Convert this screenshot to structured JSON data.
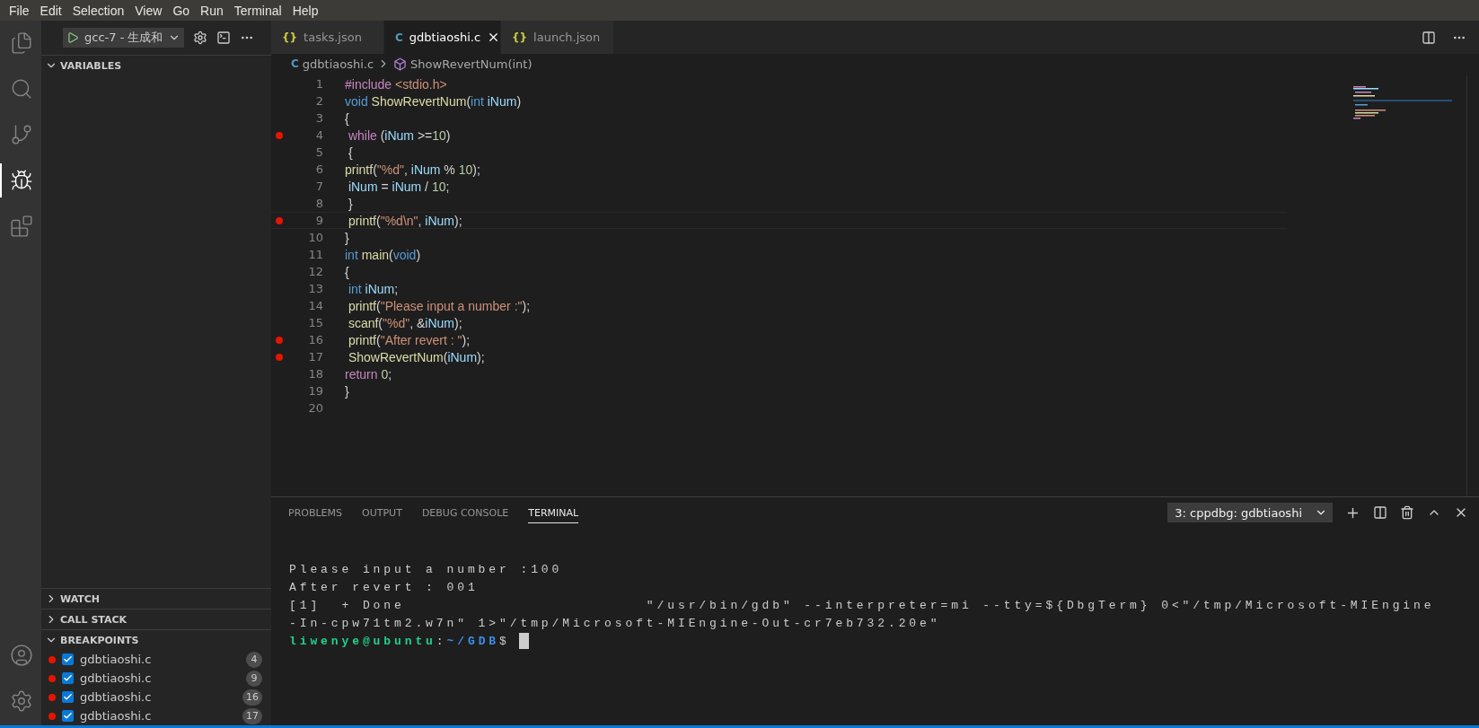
{
  "menu": [
    "File",
    "Edit",
    "Selection",
    "View",
    "Go",
    "Run",
    "Terminal",
    "Help"
  ],
  "activity_bar": [
    {
      "kind": "files",
      "selected": false
    },
    {
      "kind": "search",
      "selected": false
    },
    {
      "kind": "source-control",
      "selected": false
    },
    {
      "kind": "debug",
      "selected": true
    },
    {
      "kind": "extensions",
      "selected": false
    }
  ],
  "activity_bottom": [
    {
      "kind": "account"
    },
    {
      "kind": "settings"
    }
  ],
  "debug_toolbar": {
    "config": "gcc-7 - 生成和"
  },
  "sidebar_sections": [
    {
      "title": "VARIABLES",
      "expanded": true
    },
    {
      "title": "WATCH",
      "expanded": false
    },
    {
      "title": "CALL STACK",
      "expanded": false
    },
    {
      "title": "BREAKPOINTS",
      "expanded": true,
      "items": [
        {
          "file": "gdbtiaoshi.c",
          "checked": true,
          "line": "4"
        },
        {
          "file": "gdbtiaoshi.c",
          "checked": true,
          "line": "9"
        },
        {
          "file": "gdbtiaoshi.c",
          "checked": true,
          "line": "16"
        },
        {
          "file": "gdbtiaoshi.c",
          "checked": true,
          "line": "17"
        }
      ]
    }
  ],
  "editor_tabs": [
    {
      "icon": "{}",
      "kind": "json",
      "label": "tasks.json",
      "selected": false
    },
    {
      "icon": "C",
      "kind": "c",
      "label": "gdbtiaoshi.c",
      "selected": true
    },
    {
      "icon": "{}",
      "kind": "json",
      "label": "launch.json",
      "selected": false
    }
  ],
  "breadcrumb": {
    "file_icon": "C",
    "file": "gdbtiaoshi.c",
    "symbol": "ShowRevertNum(int)"
  },
  "code": {
    "lines": [
      {
        "number": "1",
        "breakpoint": false,
        "current": false,
        "tokens": [
          {
            "t": "#include",
            "kind": "pre"
          },
          {
            "t": " <stdio.h>",
            "kind": "str"
          }
        ]
      },
      {
        "number": "2",
        "breakpoint": false,
        "current": false,
        "tokens": [
          {
            "t": "void",
            "kind": "kw"
          },
          {
            "t": " ShowRevertNum",
            "kind": "fn"
          },
          {
            "t": "(",
            "kind": "p"
          },
          {
            "t": "int",
            "kind": "kw"
          },
          {
            "t": " iNum",
            "kind": "var"
          },
          {
            "t": ")",
            "kind": "p"
          }
        ]
      },
      {
        "number": "3",
        "breakpoint": false,
        "current": false,
        "tokens": [
          {
            "t": "{",
            "kind": "p"
          }
        ]
      },
      {
        "number": "4",
        "breakpoint": true,
        "current": false,
        "tokens": [
          {
            "t": " while",
            "kind": "ctl"
          },
          {
            "t": " (",
            "kind": "p"
          },
          {
            "t": "iNum",
            "kind": "var"
          },
          {
            "t": " >=",
            "kind": "p"
          },
          {
            "t": "10",
            "kind": "num"
          },
          {
            "t": ")",
            "kind": "p"
          }
        ]
      },
      {
        "number": "5",
        "breakpoint": false,
        "current": false,
        "tokens": [
          {
            "t": " {",
            "kind": "p"
          }
        ]
      },
      {
        "number": "6",
        "breakpoint": false,
        "current": false,
        "tokens": [
          {
            "t": "printf",
            "kind": "fn"
          },
          {
            "t": "(",
            "kind": "p"
          },
          {
            "t": "\"%d\"",
            "kind": "str"
          },
          {
            "t": ", ",
            "kind": "p"
          },
          {
            "t": "iNum",
            "kind": "var"
          },
          {
            "t": " % ",
            "kind": "p"
          },
          {
            "t": "10",
            "kind": "num"
          },
          {
            "t": ");",
            "kind": "p"
          }
        ]
      },
      {
        "number": "7",
        "breakpoint": false,
        "current": false,
        "tokens": [
          {
            "t": " iNum",
            "kind": "var"
          },
          {
            "t": " = ",
            "kind": "p"
          },
          {
            "t": "iNum",
            "kind": "var"
          },
          {
            "t": " / ",
            "kind": "p"
          },
          {
            "t": "10",
            "kind": "num"
          },
          {
            "t": ";",
            "kind": "p"
          }
        ]
      },
      {
        "number": "8",
        "breakpoint": false,
        "current": false,
        "tokens": [
          {
            "t": " }",
            "kind": "p"
          }
        ]
      },
      {
        "number": "9",
        "breakpoint": true,
        "current": true,
        "tokens": [
          {
            "t": " printf",
            "kind": "fn"
          },
          {
            "t": "(",
            "kind": "p"
          },
          {
            "t": "\"%d\\n\"",
            "kind": "str"
          },
          {
            "t": ", ",
            "kind": "p"
          },
          {
            "t": "iNum",
            "kind": "var"
          },
          {
            "t": ");",
            "kind": "p"
          }
        ]
      },
      {
        "number": "10",
        "breakpoint": false,
        "current": false,
        "tokens": [
          {
            "t": "}",
            "kind": "p"
          }
        ]
      },
      {
        "number": "11",
        "breakpoint": false,
        "current": false,
        "tokens": [
          {
            "t": "int",
            "kind": "kw"
          },
          {
            "t": " main",
            "kind": "fn"
          },
          {
            "t": "(",
            "kind": "p"
          },
          {
            "t": "void",
            "kind": "kw"
          },
          {
            "t": ")",
            "kind": "p"
          }
        ]
      },
      {
        "number": "12",
        "breakpoint": false,
        "current": false,
        "tokens": [
          {
            "t": "{",
            "kind": "p"
          }
        ]
      },
      {
        "number": "13",
        "breakpoint": false,
        "current": false,
        "tokens": [
          {
            "t": " int",
            "kind": "kw"
          },
          {
            "t": " iNum",
            "kind": "var"
          },
          {
            "t": ";",
            "kind": "p"
          }
        ]
      },
      {
        "number": "14",
        "breakpoint": false,
        "current": false,
        "tokens": [
          {
            "t": " printf",
            "kind": "fn"
          },
          {
            "t": "(",
            "kind": "p"
          },
          {
            "t": "\"Please input a number :\"",
            "kind": "str"
          },
          {
            "t": ");",
            "kind": "p"
          }
        ]
      },
      {
        "number": "15",
        "breakpoint": false,
        "current": false,
        "tokens": [
          {
            "t": " scanf",
            "kind": "fn"
          },
          {
            "t": "(",
            "kind": "p"
          },
          {
            "t": "\"%d\"",
            "kind": "str"
          },
          {
            "t": ", &",
            "kind": "p"
          },
          {
            "t": "iNum",
            "kind": "var"
          },
          {
            "t": ");",
            "kind": "p"
          }
        ]
      },
      {
        "number": "16",
        "breakpoint": true,
        "current": false,
        "tokens": [
          {
            "t": " printf",
            "kind": "fn"
          },
          {
            "t": "(",
            "kind": "p"
          },
          {
            "t": "\"After revert : \"",
            "kind": "str"
          },
          {
            "t": ");",
            "kind": "p"
          }
        ]
      },
      {
        "number": "17",
        "breakpoint": true,
        "current": false,
        "tokens": [
          {
            "t": " ShowRevertNum",
            "kind": "fn"
          },
          {
            "t": "(",
            "kind": "p"
          },
          {
            "t": "iNum",
            "kind": "var"
          },
          {
            "t": ");",
            "kind": "p"
          }
        ]
      },
      {
        "number": "18",
        "breakpoint": false,
        "current": false,
        "tokens": [
          {
            "t": "return",
            "kind": "ctl"
          },
          {
            "t": " 0",
            "kind": "num"
          },
          {
            "t": ";",
            "kind": "p"
          }
        ]
      },
      {
        "number": "19",
        "breakpoint": false,
        "current": false,
        "tokens": [
          {
            "t": "}",
            "kind": "p"
          }
        ]
      },
      {
        "number": "20",
        "breakpoint": false,
        "current": false
      }
    ]
  },
  "panel_tabs": [
    {
      "label": "PROBLEMS",
      "selected": false
    },
    {
      "label": "OUTPUT",
      "selected": false
    },
    {
      "label": "DEBUG CONSOLE",
      "selected": false
    },
    {
      "label": "TERMINAL",
      "selected": true
    }
  ],
  "terminal_select": "3: cppdbg: gdbtiaoshi",
  "terminal_lines": [
    [
      {
        "t": "Please input a number :100",
        "kind": "plain"
      }
    ],
    [
      {
        "t": "After revert : 001",
        "kind": "plain"
      }
    ],
    [
      {
        "t": "[1]  + Done                       \"/usr/bin/gdb\" --interpreter=mi --tty=${DbgTerm} 0<\"/tmp/Microsoft-MIEngine",
        "kind": "plain"
      }
    ],
    [
      {
        "t": "-In-cpw71tm2.w7n\" 1>\"/tmp/Microsoft-MIEngine-Out-cr7eb732.20e\"",
        "kind": "plain"
      }
    ],
    [
      {
        "t": "liwenye@ubuntu",
        "kind": "user"
      },
      {
        "t": ":",
        "kind": "plain"
      },
      {
        "t": "~/GDB",
        "kind": "path"
      },
      {
        "t": "$",
        "kind": "plain"
      }
    ]
  ],
  "terminal_cursor": true
}
